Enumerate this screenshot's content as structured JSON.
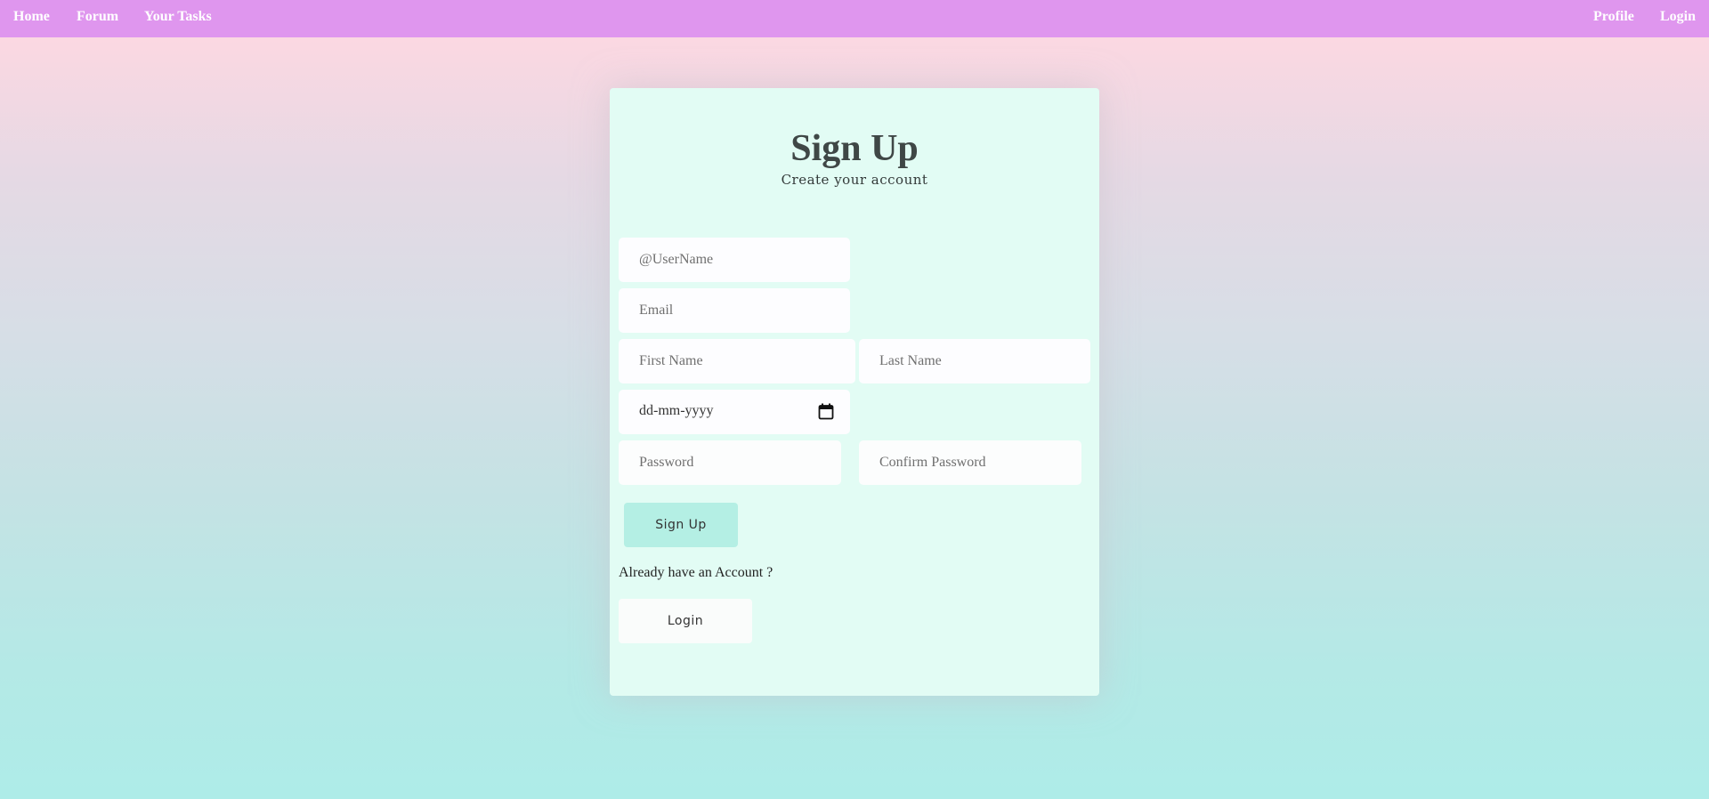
{
  "nav": {
    "home": "Home",
    "forum": "Forum",
    "tasks": "Your Tasks",
    "profile": "Profile",
    "login": "Login"
  },
  "form": {
    "title": "Sign Up",
    "subtitle": "Create your account",
    "username_placeholder": "@UserName",
    "email_placeholder": "Email",
    "first_name_placeholder": "First Name",
    "last_name_placeholder": "Last Name",
    "date_value": "dd-mm-yyyy",
    "password_placeholder": "Password",
    "confirm_password_placeholder": "Confirm Password",
    "signup_label": "Sign Up",
    "already_text": "Already have an Account ?",
    "login_label": "Login"
  },
  "colors": {
    "navbar": "#df96ee",
    "card": "#e2fcf4",
    "signup_button": "#b4efe4"
  },
  "icons": {
    "date": "calendar-icon"
  }
}
